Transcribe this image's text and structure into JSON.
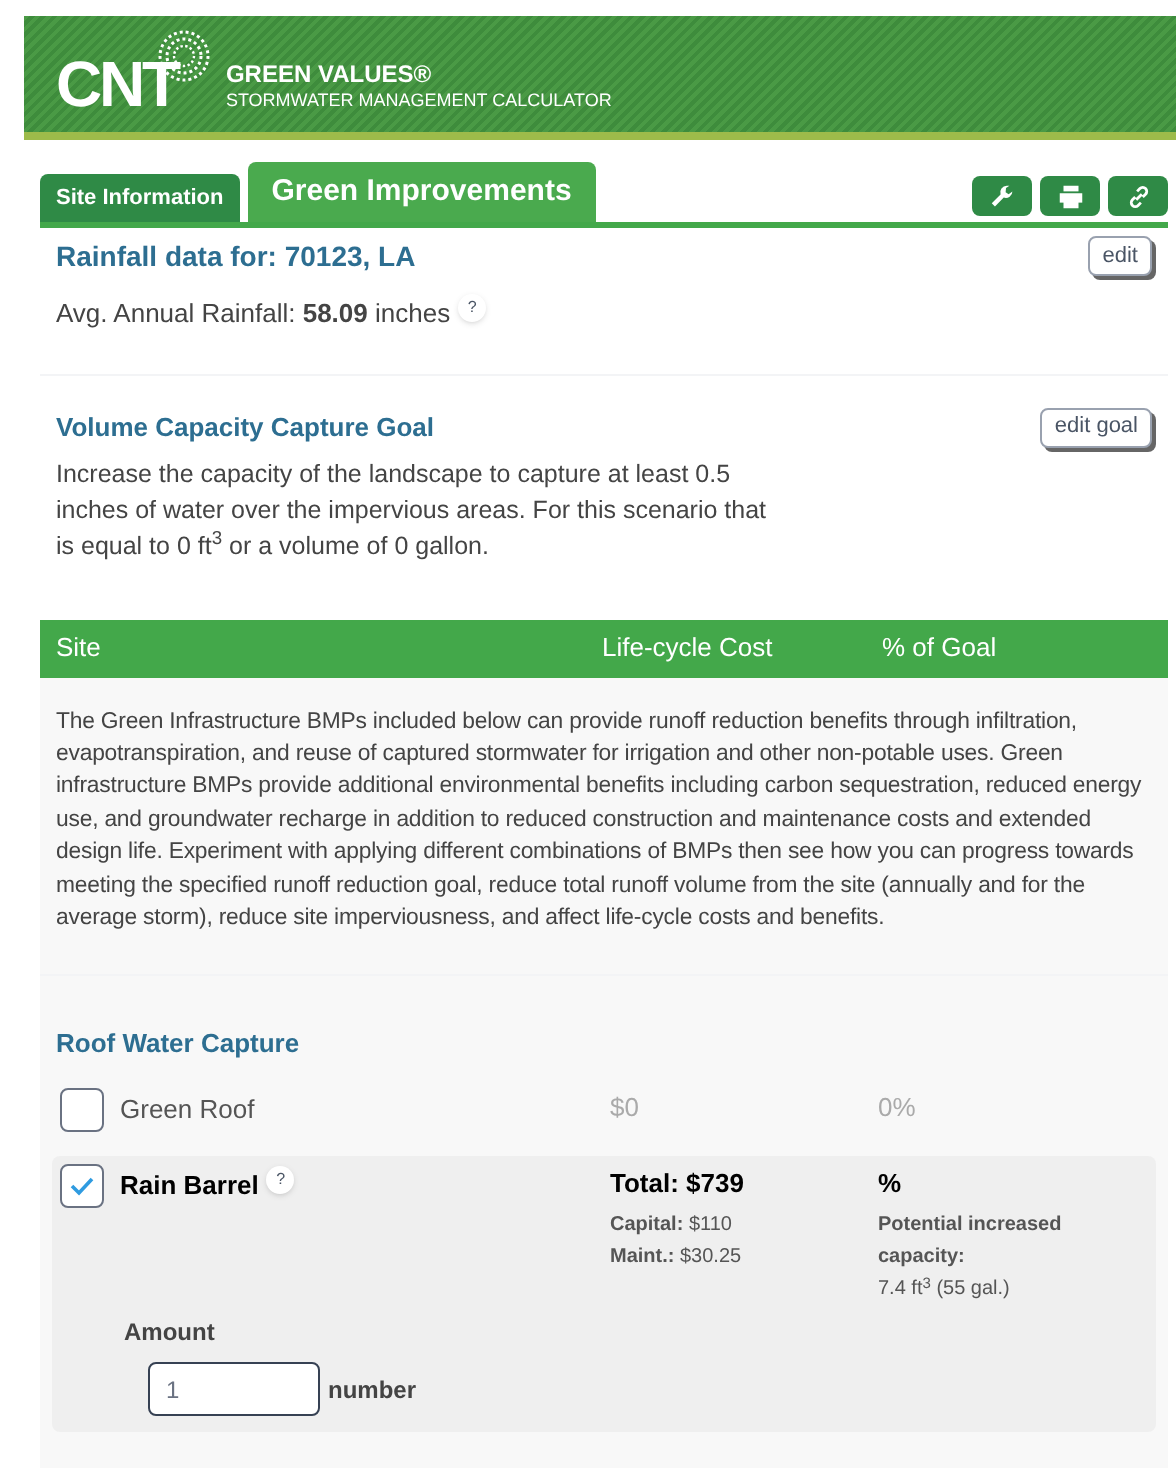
{
  "header": {
    "logo": "CNT",
    "title": "GREEN VALUES®",
    "subtitle": "STORMWATER MANAGEMENT CALCULATOR"
  },
  "tabs": [
    {
      "label": "Site Information",
      "selected": false
    },
    {
      "label": "Green Improvements",
      "selected": true
    }
  ],
  "rainfall": {
    "title": "Rainfall data for: 70123, LA",
    "edit_button": "edit",
    "text": "Avg. Annual Rainfall: **58.09** inches",
    "help": "?"
  },
  "goal": {
    "title": "Volume Capacity Capture Goal",
    "edit_button": "edit goal",
    "text": "Increase the capacity of the landscape to capture at least 0.5 inches of water over the impervious areas. For this scenario that is equal to 0 ft$^{3}$ or a volume of 0 gallon."
  },
  "table": {
    "columns": [
      "Site",
      "Life-cycle Cost",
      "% of Goal"
    ],
    "description": "The Green Infrastructure BMPs included below can provide runoff reduction benefits through infiltration, evapotranspiration, and reuse of captured stormwater for irrigation and other non-potable uses. Green infrastructure BMPs provide additional environmental benefits including carbon sequestration, reduced energy use, and groundwater recharge in addition to reduced construction and maintenance costs and extended design life. Experiment with applying different combinations of BMPs then see how you can progress towards meeting the specified runoff reduction goal, reduce total runoff volume from the site (annually and for the average storm), reduce site imperviousness, and affect life-cycle costs and benefits.",
    "section": "Roof Water Capture",
    "items": [
      {
        "name": "Green Roof",
        "checked": false,
        "cost": "$0",
        "goal": "0%"
      },
      {
        "name": "Rain Barrel",
        "checked": true,
        "help": "?",
        "cost": "Total: $739",
        "goal": "%",
        "cost_lines": [
          "**Capital:** $110",
          "**Maint.:** $30.25"
        ],
        "capacity_label": "Potential increased capacity:",
        "capacity": "7.4 ft$^{3}$ (55 gal.)",
        "amount_label": "Amount",
        "amount_value": "1",
        "amount_unit": "number"
      }
    ]
  }
}
